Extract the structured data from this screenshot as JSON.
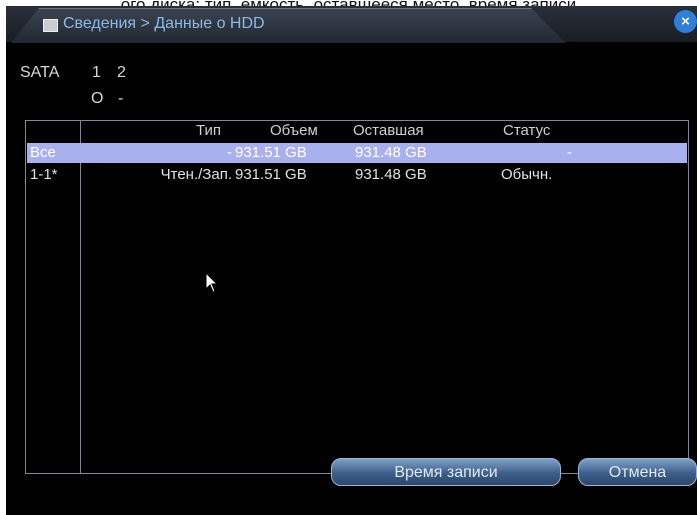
{
  "page": {
    "caption": "ого диска: тип, емкость, оставшееся место, время записи"
  },
  "window": {
    "title": "Сведения > Данные о HDD",
    "close_glyph": "×"
  },
  "sata": {
    "label": "SATA",
    "ports": [
      "1",
      "2"
    ],
    "statuses": [
      "O",
      "-"
    ]
  },
  "table": {
    "headers": [
      "Тип",
      "Объем",
      "Оставшая",
      "Статус"
    ],
    "rows": [
      {
        "name": "Все",
        "type": "-",
        "capacity": "931.51 GB",
        "remaining": "931.48 GB",
        "status": "-"
      },
      {
        "name": "1-1*",
        "type": "Чтен./Зап.",
        "capacity": "931.51 GB",
        "remaining": "931.48 GB",
        "status": "Обычн."
      }
    ]
  },
  "buttons": {
    "record_time": "Время записи",
    "cancel": "Отмена"
  },
  "icons": {
    "title_icon": "info-icon",
    "close_icon": "close-icon",
    "cursor": "mouse-pointer-icon"
  },
  "colors": {
    "selection": "#a8b0ee",
    "accent_blue": "#2f7fd6"
  }
}
